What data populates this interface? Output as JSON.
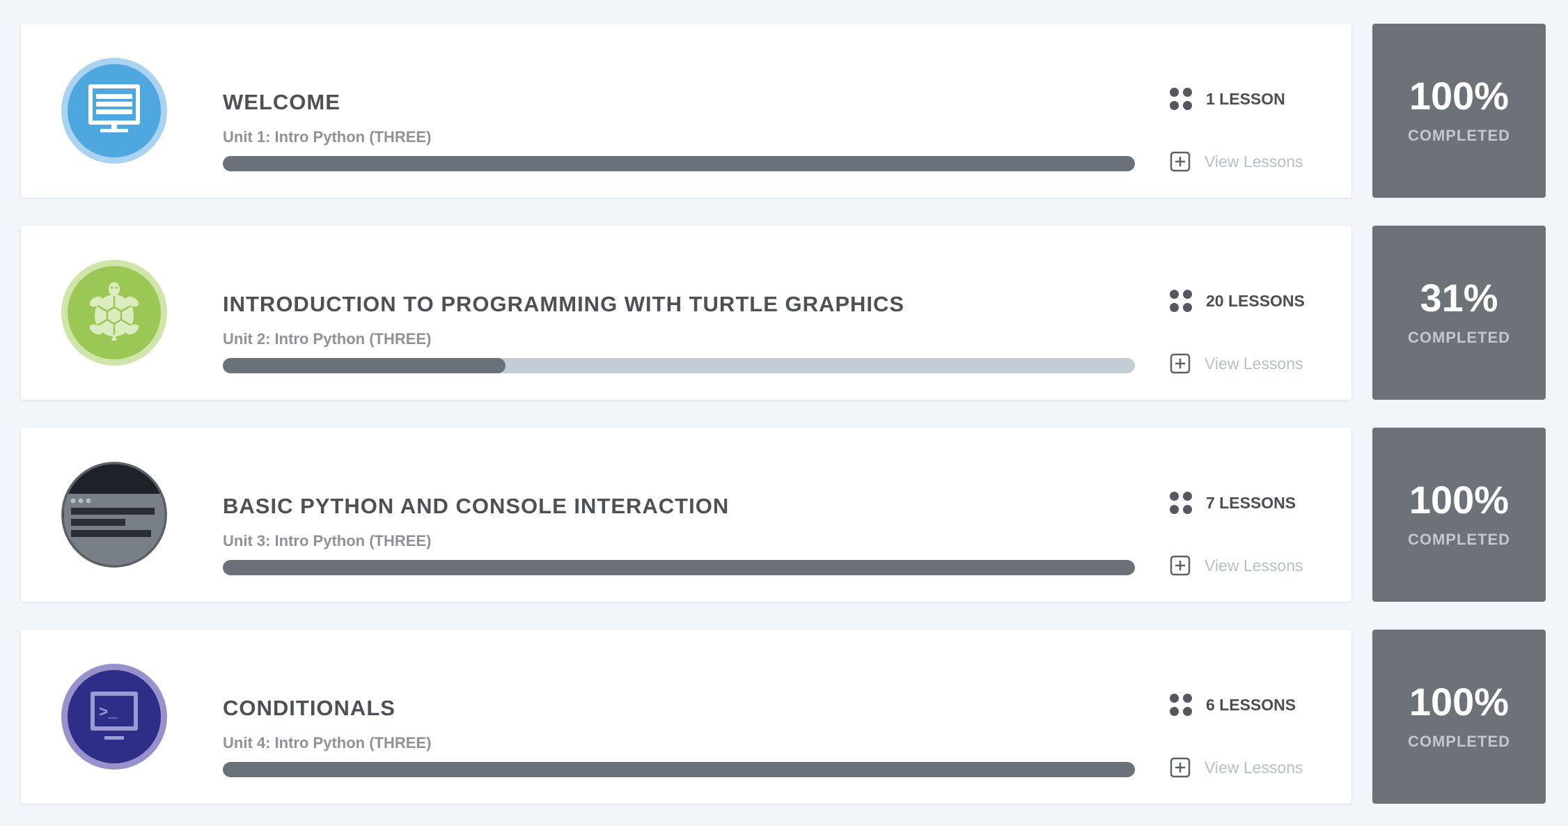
{
  "units": [
    {
      "title": "WELCOME",
      "subtitle": "Unit 1: Intro Python (THREE)",
      "lessons_label": "1 LESSON",
      "view_label": "View Lessons",
      "progress_fraction": 1.0,
      "percent_text": "100%",
      "completed_label": "COMPLETED",
      "icon": "computer-monitor-icon",
      "icon_color": "#4ea7df"
    },
    {
      "title": "INTRODUCTION TO PROGRAMMING WITH TURTLE GRAPHICS",
      "subtitle": "Unit 2: Intro Python (THREE)",
      "lessons_label": "20 LESSONS",
      "view_label": "View Lessons",
      "progress_fraction": 0.31,
      "percent_text": "31%",
      "completed_label": "COMPLETED",
      "icon": "turtle-icon",
      "icon_color": "#9bc855"
    },
    {
      "title": "BASIC PYTHON AND CONSOLE INTERACTION",
      "subtitle": "Unit 3: Intro Python (THREE)",
      "lessons_label": "7 LESSONS",
      "view_label": "View Lessons",
      "progress_fraction": 1.0,
      "percent_text": "100%",
      "completed_label": "COMPLETED",
      "icon": "browser-window-icon",
      "icon_color": "#1e2228"
    },
    {
      "title": "CONDITIONALS",
      "subtitle": "Unit 4: Intro Python (THREE)",
      "lessons_label": "6 LESSONS",
      "view_label": "View Lessons",
      "progress_fraction": 1.0,
      "percent_text": "100%",
      "completed_label": "COMPLETED",
      "icon": "terminal-icon",
      "icon_color": "#2e2d88"
    }
  ]
}
